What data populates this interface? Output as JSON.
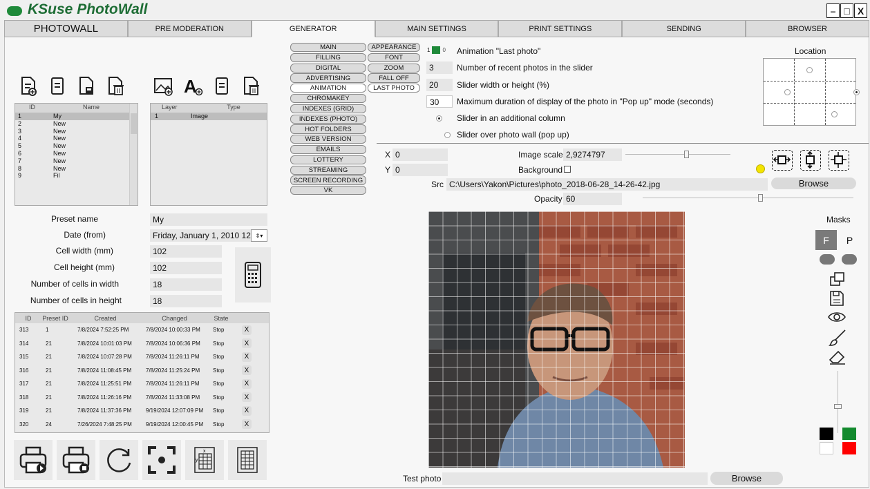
{
  "app": {
    "title": "KSuse PhotoWall"
  },
  "window": {
    "minimize": "–",
    "maximize": "□",
    "close": "X"
  },
  "tabs": [
    "PHOTOWALL",
    "PRE MODERATION",
    "GENERATOR",
    "MAIN SETTINGS",
    "PRINT SETTINGS",
    "SENDING",
    "BROWSER"
  ],
  "presets": {
    "headers": [
      "ID",
      "Name"
    ],
    "rows": [
      [
        "1",
        "My"
      ],
      [
        "2",
        "New"
      ],
      [
        "3",
        "New"
      ],
      [
        "4",
        "New"
      ],
      [
        "5",
        "New"
      ],
      [
        "6",
        "New"
      ],
      [
        "7",
        "New"
      ],
      [
        "8",
        "New"
      ],
      [
        "9",
        "Fil"
      ]
    ]
  },
  "layers": {
    "headers": [
      "Layer",
      "Type"
    ],
    "rows": [
      [
        "1",
        "Image"
      ]
    ]
  },
  "form": {
    "preset_name": {
      "label": "Preset name",
      "value": "My"
    },
    "date_from": {
      "label": "Date (from)",
      "value": "Friday, January 1, 2010 12:"
    },
    "cell_width": {
      "label": "Cell width (mm)",
      "value": "102"
    },
    "cell_height": {
      "label": "Cell height (mm)",
      "value": "102"
    },
    "cells_w": {
      "label": "Number of cells in width",
      "value": "18"
    },
    "cells_h": {
      "label": "Number of cells in height",
      "value": "18"
    }
  },
  "history": {
    "headers": [
      "ID",
      "Preset ID",
      "Created",
      "Changed",
      "State"
    ],
    "rows": [
      [
        "313",
        "1",
        "7/8/2024 7:52:25 PM",
        "7/8/2024 10:00:33 PM",
        "Stop"
      ],
      [
        "314",
        "21",
        "7/8/2024 10:01:03 PM",
        "7/8/2024 10:06:36 PM",
        "Stop"
      ],
      [
        "315",
        "21",
        "7/8/2024 10:07:28 PM",
        "7/8/2024 11:26:11 PM",
        "Stop"
      ],
      [
        "316",
        "21",
        "7/8/2024 11:08:45 PM",
        "7/8/2024 11:25:24 PM",
        "Stop"
      ],
      [
        "317",
        "21",
        "7/8/2024 11:25:51 PM",
        "7/8/2024 11:26:11 PM",
        "Stop"
      ],
      [
        "318",
        "21",
        "7/8/2024 11:26:16 PM",
        "7/8/2024 11:33:08 PM",
        "Stop"
      ],
      [
        "319",
        "21",
        "7/8/2024 11:37:36 PM",
        "9/19/2024 12:07:09 PM",
        "Stop"
      ],
      [
        "320",
        "24",
        "7/26/2024 7:48:25 PM",
        "9/19/2024 12:00:45 PM",
        "Stop"
      ]
    ],
    "delete": "X"
  },
  "sections": [
    "MAIN",
    "FILLING",
    "DIGITAL",
    "ADVERTISING",
    "ANIMATION",
    "CHROMAKEY",
    "INDEXES (GRID)",
    "INDEXES (PHOTO)",
    "HOT FOLDERS",
    "WEB VERSION",
    "EMAILS",
    "LOTTERY",
    "STREAMING",
    "SCREEN RECORDING",
    "VK"
  ],
  "subsections": [
    "APPEARANCE",
    "FONT",
    "ZOOM",
    "FALL OFF",
    "LAST PHOTO"
  ],
  "animation": {
    "toggle_label": "Animation \"Last photo\"",
    "toggle_on": "1",
    "toggle_off": "0",
    "recent": {
      "value": "3",
      "label": "Number of recent photos in the slider"
    },
    "slider_size": {
      "value": "20",
      "label": "Slider width or height (%)"
    },
    "duration": {
      "value": "30",
      "label": "Maximum duration of display of the photo in \"Pop up\" mode (seconds)"
    },
    "opt1": "Slider in an additional column",
    "opt2": "Slider over photo wall (pop up)"
  },
  "location": {
    "label": "Location"
  },
  "layer_props": {
    "x_label": "X",
    "x_value": "0",
    "y_label": "Y",
    "y_value": "0",
    "scale_label": "Image scale",
    "scale_value": "2,9274797",
    "background_label": "Background",
    "src_label": "Src",
    "src_value": "C:\\Users\\Yakon\\Pictures\\photo_2018-06-28_14-26-42.jpg",
    "browse": "Browse",
    "opacity_label": "Opacity",
    "opacity_value": "60"
  },
  "masks": {
    "label": "Masks",
    "f": "F",
    "p": "P"
  },
  "test_photo": {
    "label": "Test photo",
    "value": "",
    "browse": "Browse"
  },
  "colors": {
    "logo": "#1f8a3a",
    "toggle": "#1f8a3a",
    "indicator": "#f3e400",
    "swatches": [
      "#000000",
      "#138a2e",
      "#ffffff",
      "#ff0000"
    ]
  }
}
